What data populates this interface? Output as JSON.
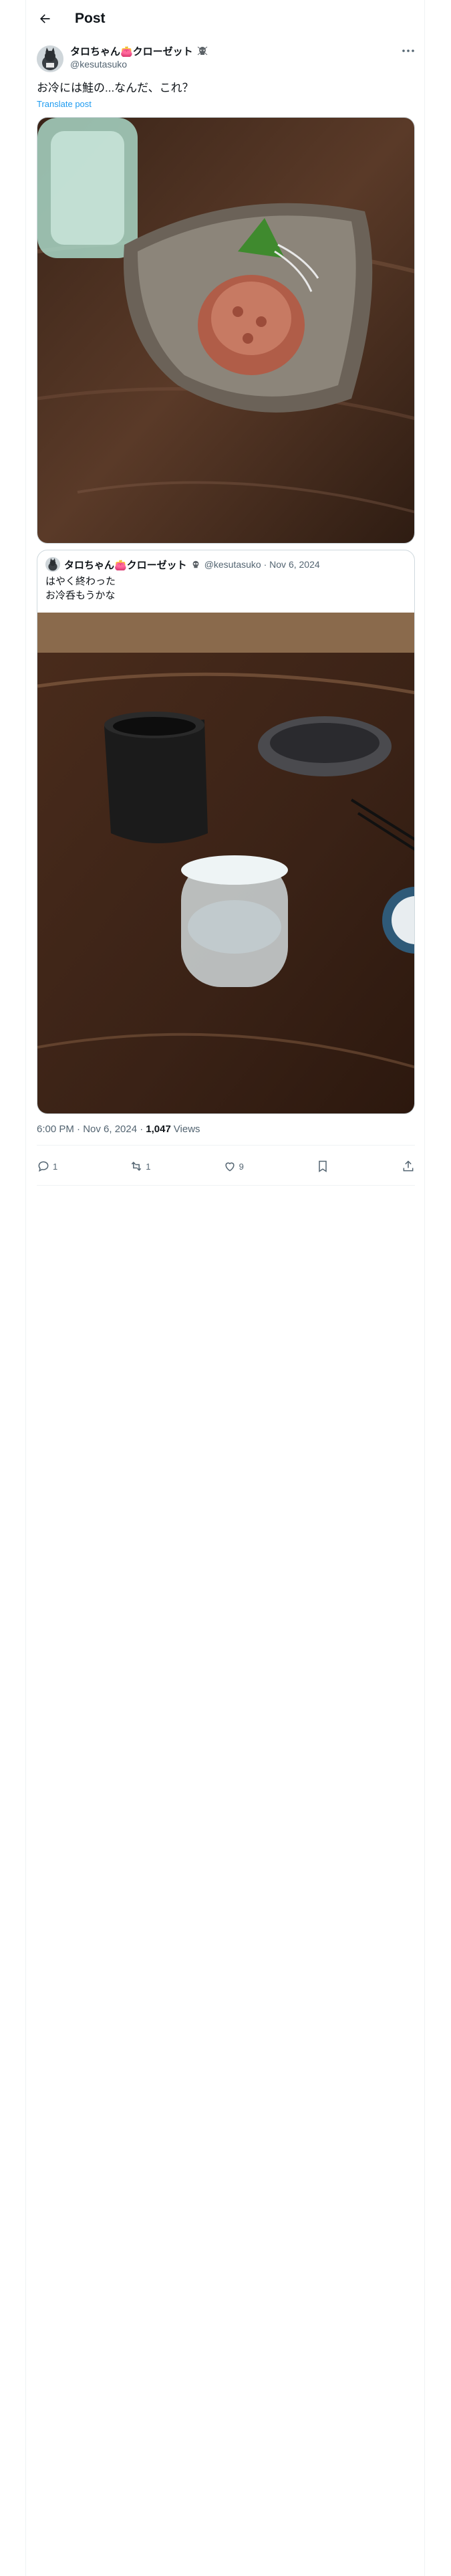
{
  "header": {
    "title": "Post",
    "back_icon": "arrow-left-icon"
  },
  "tweet": {
    "display_name": "タロちゃん👛クローゼット",
    "badge_icon": "skull-badge-icon",
    "handle": "@kesutasuko",
    "text": "お冷には鮭の...なんだ、これ？",
    "translate_label": "Translate post",
    "more_icon": "more-dots-icon",
    "image_description_icon": "photo-salmon-dish"
  },
  "quote": {
    "display_name": "タロちゃん👛クローゼット",
    "handle_date": "@kesutasuko · Nov 6, 2024",
    "text": "はやく終わった\nお冷呑もうかな",
    "image_icon": "photo-sake-set"
  },
  "meta": {
    "time_date": "6:00 PM · Nov 6, 2024 ·",
    "views_count": "1,047",
    "views_label": "Views"
  },
  "actions": {
    "reply_count": "1",
    "repost_count": "1",
    "like_count": "9",
    "bookmark_icon": "bookmark-icon",
    "share_icon": "share-icon"
  },
  "colors": {
    "accent": "#1d9bf0",
    "text": "#0f1419",
    "muted": "#536471",
    "border": "#cfd9de"
  }
}
